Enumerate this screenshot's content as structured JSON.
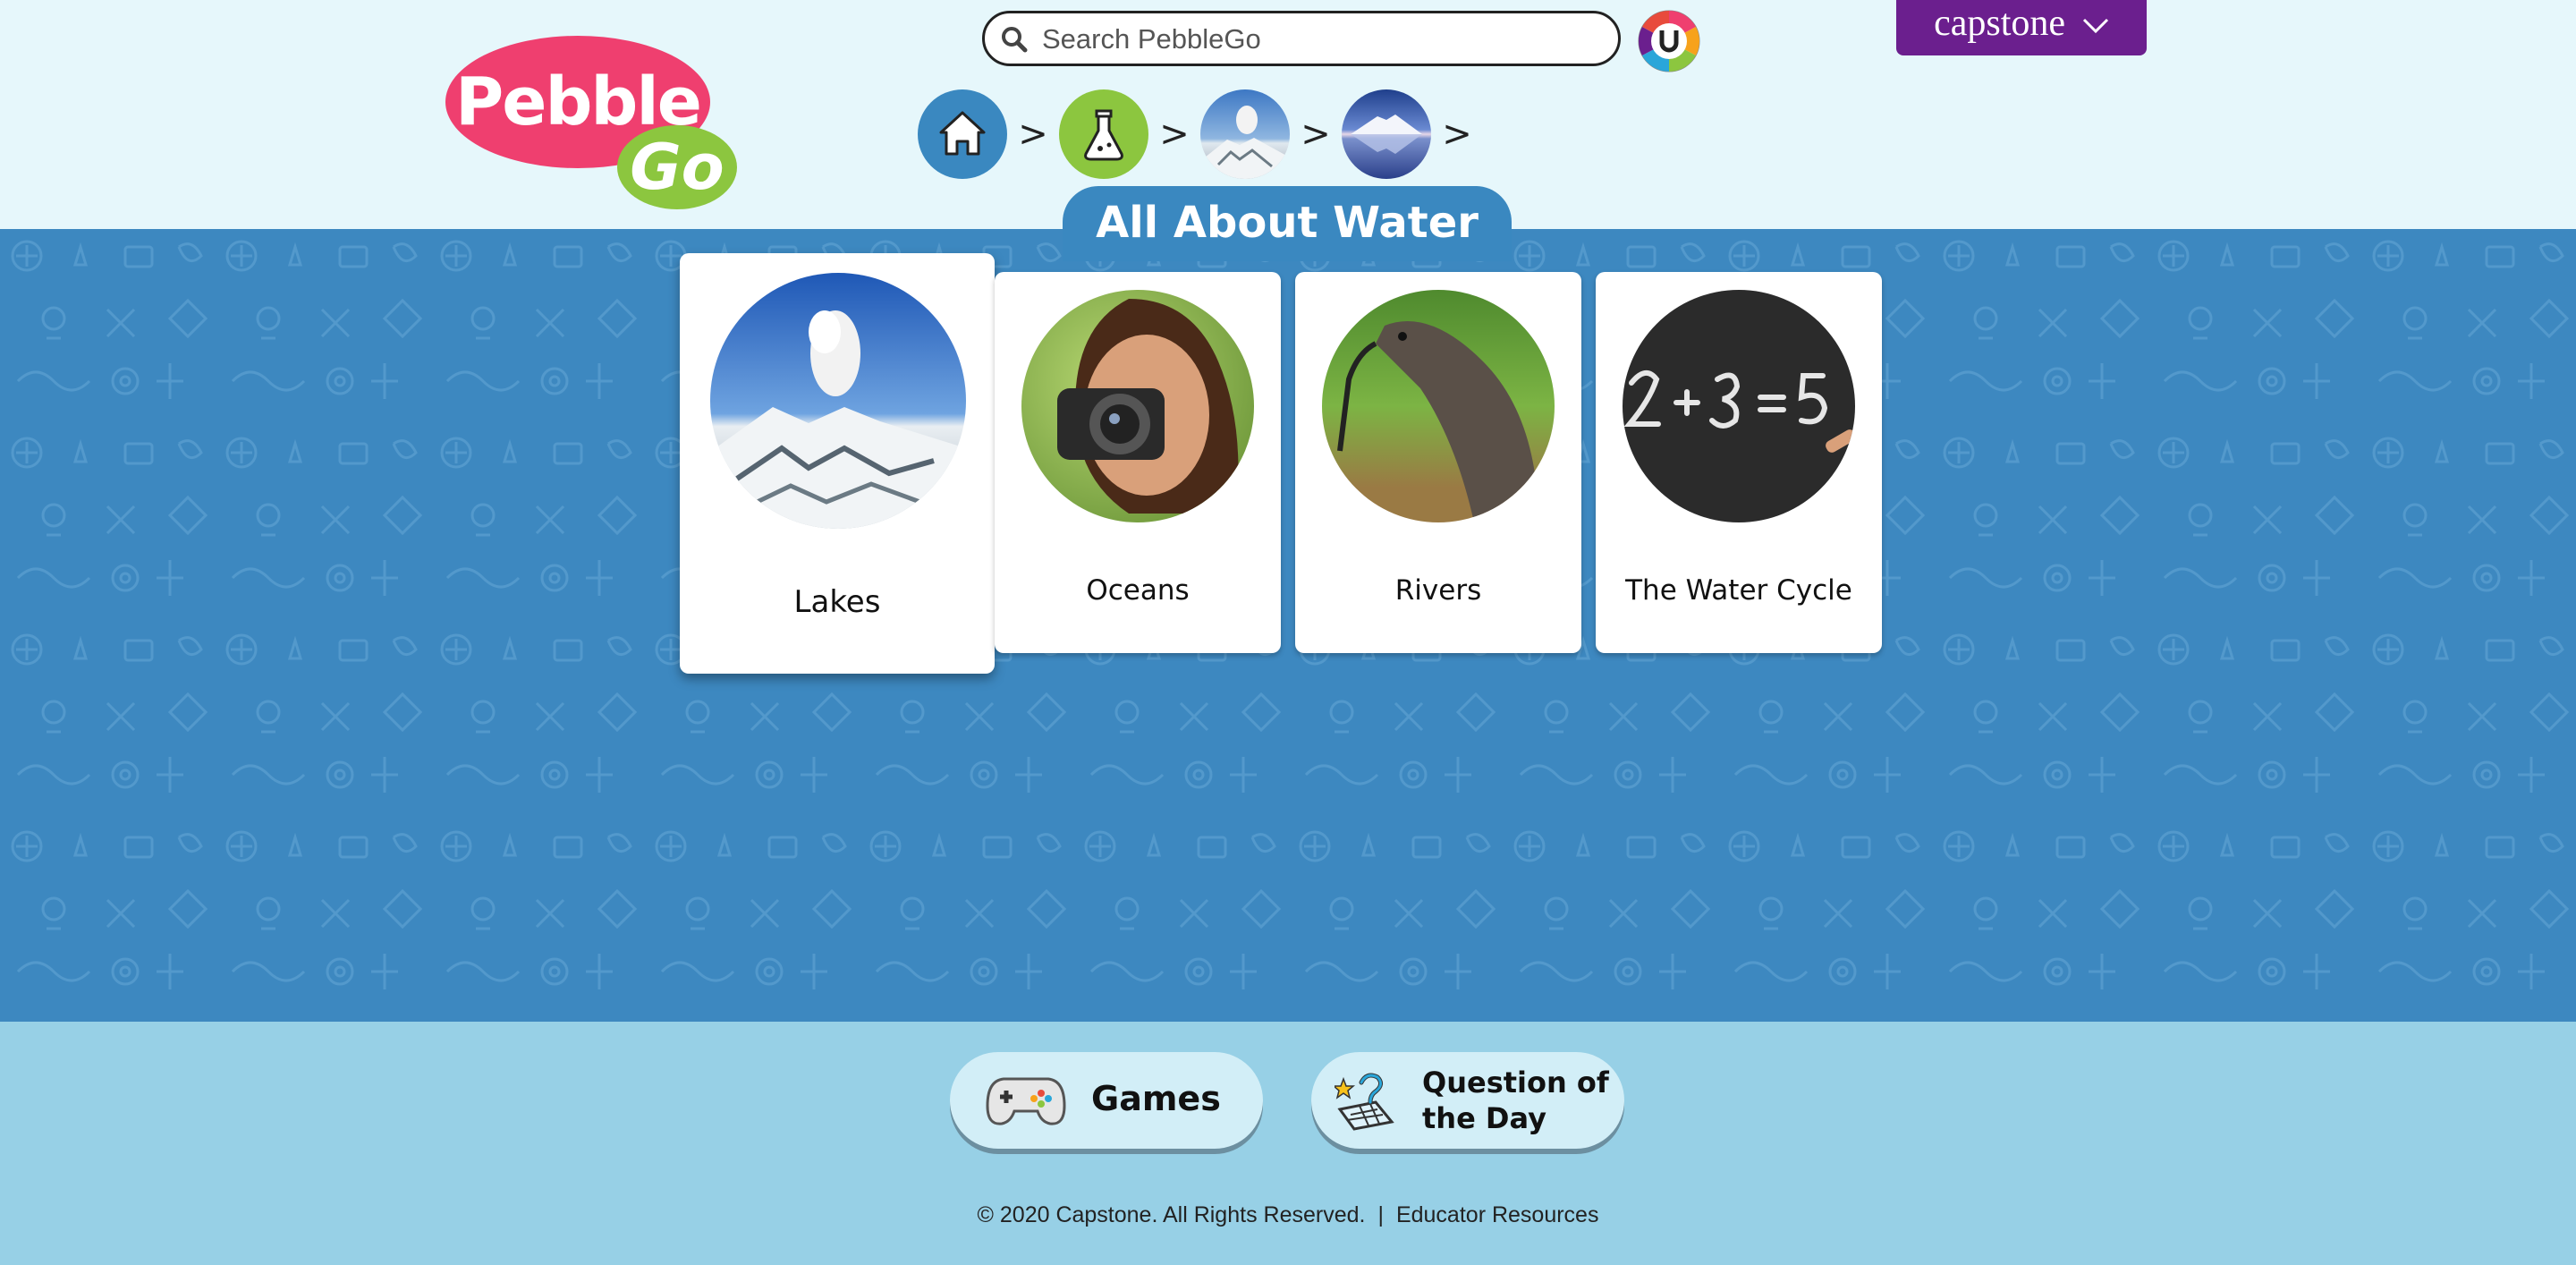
{
  "header": {
    "logo_pebble": "Pebble",
    "logo_go": "Go",
    "search_placeholder": "Search PebbleGo",
    "brand_menu": "capstone",
    "breadcrumb": [
      {
        "icon": "home-icon"
      },
      {
        "icon": "science-flask-icon"
      },
      {
        "icon": "volcano-photo"
      },
      {
        "icon": "lake-photo"
      }
    ],
    "separator": ">"
  },
  "page_title": "All About Water",
  "cards": [
    {
      "label": "Lakes",
      "image": "snowy-volcano-photo"
    },
    {
      "label": "Oceans",
      "image": "girl-with-camera-photo"
    },
    {
      "label": "Rivers",
      "image": "anteater-photo"
    },
    {
      "label": "The Water Cycle",
      "image": "chalkboard-math-photo"
    }
  ],
  "footer": {
    "games_label": "Games",
    "qotd_line1": "Question of",
    "qotd_line2": "the Day",
    "copyright": "© 2020 Capstone. All Rights Reserved.",
    "divider": "|",
    "educator_link": "Educator Resources"
  },
  "colors": {
    "header_bg": "#e6f7fb",
    "main_bg": "#3d88c0",
    "footer_bg": "#97d0e6",
    "brand_purple": "#6b1f8e",
    "logo_pink": "#ef3f6f",
    "logo_green": "#8cc63f"
  }
}
